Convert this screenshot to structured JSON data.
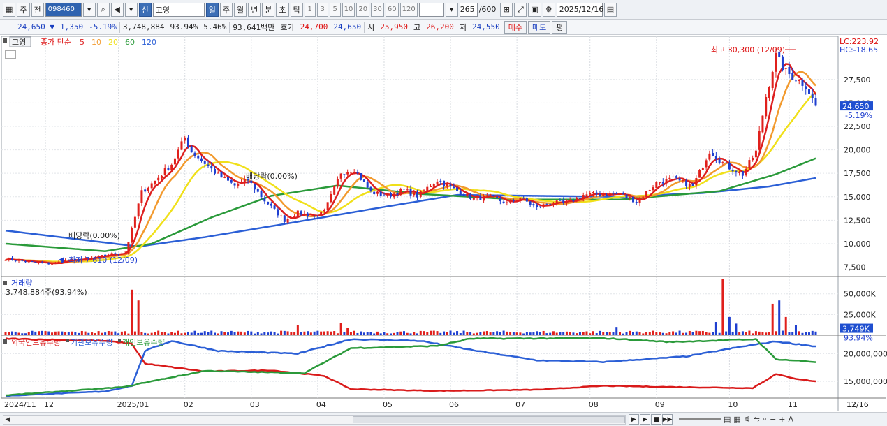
{
  "toolbar": {
    "period_label": "주",
    "prev_label": "전",
    "stock_code": "098460",
    "stock_badge": "신",
    "stock_name": "고영",
    "timeframes": [
      "일",
      "주",
      "월",
      "년",
      "분",
      "초",
      "틱"
    ],
    "active_timeframe": "일",
    "minute_options": [
      "1",
      "3",
      "5",
      "10",
      "20",
      "30",
      "60",
      "120"
    ],
    "count_value": "265",
    "count_total": "/600",
    "date_value": "2025/12/16"
  },
  "quote": {
    "price": "24,650",
    "change": "1,350",
    "change_pct": "-5.19%",
    "volume": "3,748,884",
    "volume_ratio": "93.94%",
    "turnover": "5.46%",
    "amount": "93,641백만",
    "bid_label": "호가",
    "bid1": "24,700",
    "bid2": "24,650",
    "open_label": "시",
    "open": "25,950",
    "high_label": "고",
    "high": "26,200",
    "low_label": "저",
    "low": "24,550",
    "buy_label": "매수",
    "sell_label": "매도",
    "avg_label": "평"
  },
  "chart_data": {
    "type": "candlestick",
    "price_panel": {
      "legend_name": "고영",
      "legend_ma": "종가 단순",
      "ma_periods": [
        {
          "period": "5",
          "color": "#dd1f1f"
        },
        {
          "period": "10",
          "color": "#f29a2e"
        },
        {
          "period": "20",
          "color": "#f0e01a"
        },
        {
          "period": "60",
          "color": "#2a9a3a"
        },
        {
          "period": "120",
          "color": "#2b5fd6"
        }
      ],
      "y_ticks": [
        "27,500",
        "25,000",
        "22,500",
        "20,000",
        "17,500",
        "15,000",
        "12,500",
        "10,000",
        "7,500"
      ],
      "ylim": [
        6500,
        31800
      ],
      "lc": "LC:223.92",
      "hc": "HC:-18.65",
      "current_price": "24,650",
      "current_pct": "-5.19%",
      "max_label": "최고 30,300 (12/09)",
      "min_label": "최저 7,610 (12/09)",
      "dividend_labels": [
        "배당락(0.00%)",
        "배당락(0.00%)"
      ],
      "close_anchors": [
        [
          0,
          8400
        ],
        [
          5,
          8150
        ],
        [
          10,
          7950
        ],
        [
          14,
          7850
        ],
        [
          18,
          8200
        ],
        [
          24,
          8350
        ],
        [
          28,
          8600
        ],
        [
          32,
          8900
        ],
        [
          36,
          9050
        ],
        [
          38,
          11500
        ],
        [
          41,
          15500
        ],
        [
          45,
          16700
        ],
        [
          50,
          18500
        ],
        [
          54,
          21300
        ],
        [
          56,
          19800
        ],
        [
          60,
          18600
        ],
        [
          64,
          17300
        ],
        [
          69,
          16200
        ],
        [
          73,
          16800
        ],
        [
          78,
          14600
        ],
        [
          84,
          12500
        ],
        [
          88,
          13300
        ],
        [
          93,
          12900
        ],
        [
          96,
          13400
        ],
        [
          101,
          17600
        ],
        [
          105,
          17900
        ],
        [
          110,
          15500
        ],
        [
          115,
          15100
        ],
        [
          120,
          15700
        ],
        [
          124,
          15100
        ],
        [
          130,
          16800
        ],
        [
          136,
          15600
        ],
        [
          141,
          14800
        ],
        [
          146,
          15000
        ],
        [
          151,
          14300
        ],
        [
          155,
          14900
        ],
        [
          160,
          13800
        ],
        [
          164,
          14400
        ],
        [
          169,
          14300
        ],
        [
          174,
          15200
        ],
        [
          179,
          15300
        ],
        [
          185,
          15300
        ],
        [
          190,
          14500
        ],
        [
          196,
          16500
        ],
        [
          201,
          16900
        ],
        [
          207,
          16100
        ],
        [
          212,
          19900
        ],
        [
          217,
          18300
        ],
        [
          222,
          17400
        ],
        [
          226,
          19800
        ],
        [
          229,
          25700
        ],
        [
          232,
          30000
        ],
        [
          235,
          28300
        ],
        [
          238,
          27600
        ],
        [
          241,
          26900
        ],
        [
          244,
          24650
        ]
      ],
      "ma120_anchors": [
        [
          0,
          11400
        ],
        [
          40,
          9700
        ],
        [
          60,
          10700
        ],
        [
          84,
          12100
        ],
        [
          112,
          13800
        ],
        [
          136,
          15200
        ],
        [
          160,
          15100
        ],
        [
          185,
          15000
        ],
        [
          210,
          15400
        ],
        [
          230,
          16100
        ],
        [
          244,
          17000
        ]
      ],
      "ma60_anchors": [
        [
          0,
          10000
        ],
        [
          30,
          9200
        ],
        [
          44,
          10000
        ],
        [
          62,
          12800
        ],
        [
          80,
          15100
        ],
        [
          100,
          16200
        ],
        [
          125,
          15300
        ],
        [
          155,
          14700
        ],
        [
          185,
          14700
        ],
        [
          215,
          15600
        ],
        [
          232,
          17400
        ],
        [
          244,
          19100
        ]
      ]
    },
    "volume_panel": {
      "title": "거래량",
      "value_label": "3,748,884주(93.94%)",
      "y_ticks": [
        "50,000K",
        "25,000K"
      ],
      "current": "3,749K",
      "current_pct": "93.94%",
      "ylim": [
        0,
        70000
      ],
      "spikes": [
        [
          38,
          55000
        ],
        [
          40,
          42000
        ],
        [
          88,
          12000
        ],
        [
          101,
          15000
        ],
        [
          103,
          9000
        ],
        [
          184,
          10000
        ],
        [
          214,
          16000
        ],
        [
          216,
          68000
        ],
        [
          218,
          22000
        ],
        [
          220,
          14000
        ],
        [
          231,
          38000
        ],
        [
          233,
          42000
        ],
        [
          235,
          22000
        ],
        [
          238,
          12000
        ]
      ]
    },
    "holdings_panel": {
      "series": [
        {
          "name": "외국인보유수량",
          "color": "#d91a1a"
        },
        {
          "name": "기관보유수량",
          "color": "#2b5fd6"
        },
        {
          "name": "개인보유수량",
          "color": "#2a9a3a"
        }
      ],
      "y_ticks": [
        "20,000,000",
        "15,000,000"
      ],
      "ylim": [
        12000000,
        23200000
      ]
    },
    "x_ticks": [
      "2024/11",
      "12",
      "2025/01",
      "02",
      "03",
      "04",
      "05",
      "06",
      "07",
      "08",
      "09",
      "10",
      "11",
      "12",
      "12/16"
    ]
  }
}
